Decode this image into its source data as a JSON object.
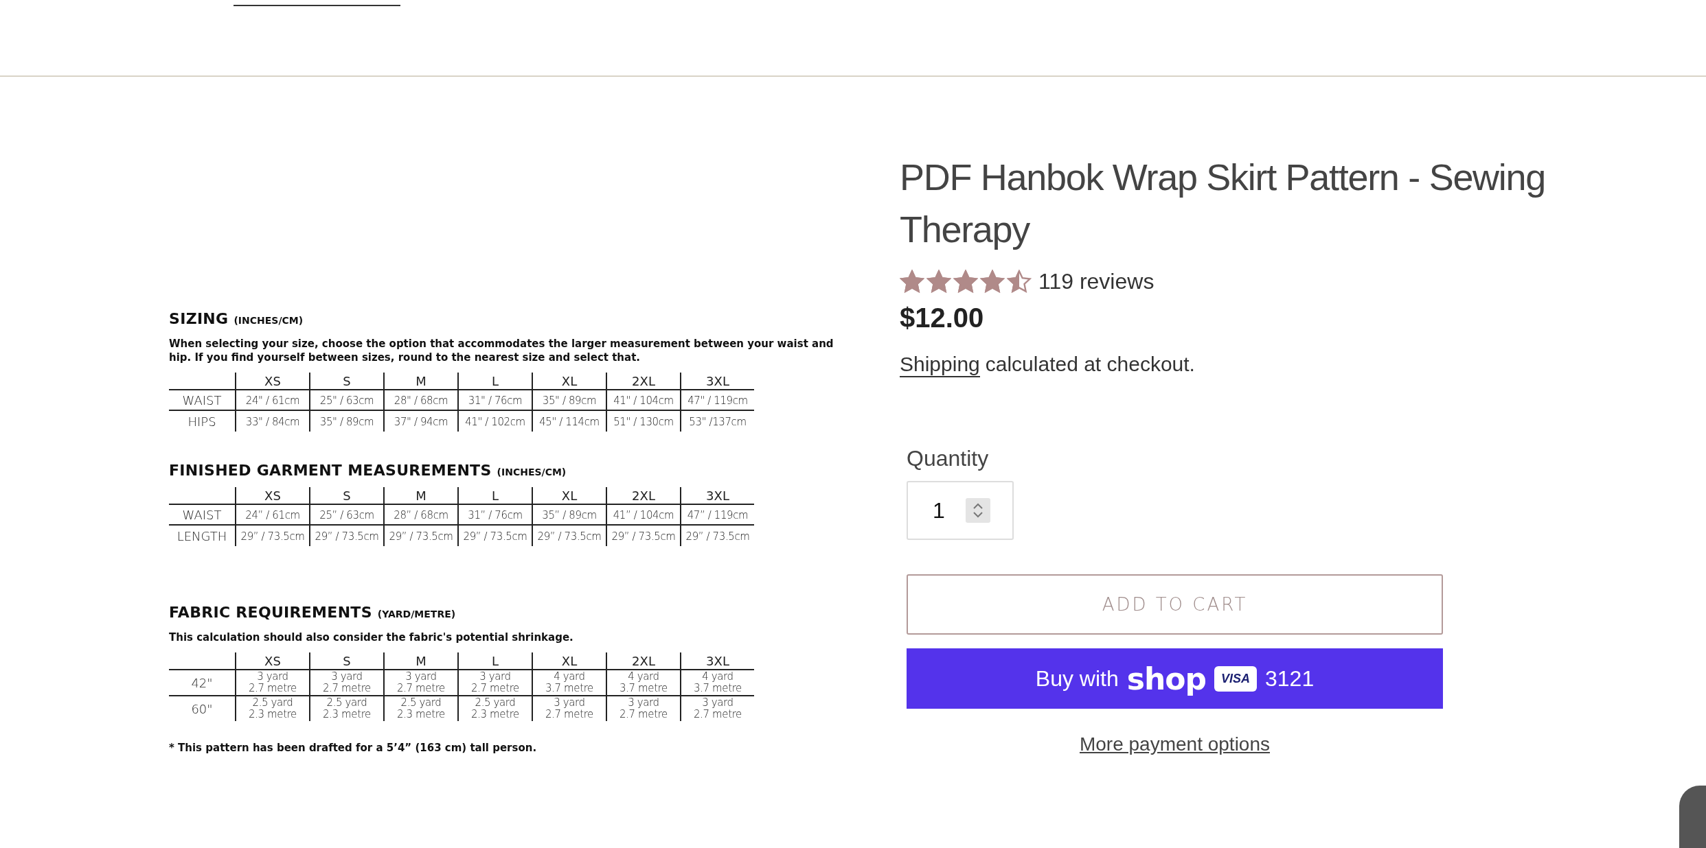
{
  "size_chart": {
    "sections": [
      {
        "heading": "SIZING",
        "unit": "(INCHES/CM)",
        "note": "When selecting your size, choose the option that accommodates the larger measurement between your waist and hip. If you find yourself between sizes, round to the nearest size and select that.",
        "columns": [
          "XS",
          "S",
          "M",
          "L",
          "XL",
          "2XL",
          "3XL"
        ],
        "rows": [
          {
            "label": "WAIST",
            "cells": [
              "24\" / 61cm",
              "25\" / 63cm",
              "28\" / 68cm",
              "31\" / 76cm",
              "35\" / 89cm",
              "41\" / 104cm",
              "47\" / 119cm"
            ]
          },
          {
            "label": "HIPS",
            "cells": [
              "33\" / 84cm",
              "35\" / 89cm",
              "37\" / 94cm",
              "41\" / 102cm",
              "45\" / 114cm",
              "51\" / 130cm",
              "53\" /137cm"
            ]
          }
        ]
      },
      {
        "heading": "FINISHED GARMENT MEASUREMENTS",
        "unit": "(INCHES/CM)",
        "columns": [
          "XS",
          "S",
          "M",
          "L",
          "XL",
          "2XL",
          "3XL"
        ],
        "rows": [
          {
            "label": "WAIST",
            "cells": [
              "24” / 61cm",
              "25” / 63cm",
              "28” / 68cm",
              "31” / 76cm",
              "35” / 89cm",
              "41” / 104cm",
              "47” / 119cm"
            ]
          },
          {
            "label": "LENGTH",
            "cells": [
              "29” / 73.5cm",
              "29” / 73.5cm",
              "29” / 73.5cm",
              "29” / 73.5cm",
              "29” / 73.5cm",
              "29” / 73.5cm",
              "29” / 73.5cm"
            ]
          }
        ]
      },
      {
        "heading": "FABRIC REQUIREMENTS",
        "unit": "(YARD/METRE)",
        "note": "This calculation should also consider the fabric's potential shrinkage.",
        "columns": [
          "XS",
          "S",
          "M",
          "L",
          "XL",
          "2XL",
          "3XL"
        ],
        "rows": [
          {
            "label": "42\"",
            "cells": [
              "3 yard\n2.7 metre",
              "3 yard\n2.7 metre",
              "3 yard\n2.7 metre",
              "3 yard\n2.7 metre",
              "4 yard\n3.7 metre",
              "4 yard\n3.7 metre",
              "4 yard\n3.7 metre"
            ]
          },
          {
            "label": "60\"",
            "cells": [
              "2.5 yard\n2.3 metre",
              "2.5 yard\n2.3 metre",
              "2.5 yard\n2.3 metre",
              "2.5 yard\n2.3 metre",
              "3 yard\n2.7 metre",
              "3 yard\n2.7 metre",
              "3 yard\n2.7 metre"
            ]
          }
        ]
      }
    ],
    "footnote": "* This pattern has been drafted for a 5’4” (163 cm) tall person."
  },
  "product": {
    "title": "PDF Hanbok Wrap Skirt Pattern - Sewing Therapy",
    "stars": 4.5,
    "reviews": "119 reviews",
    "price": "$12.00",
    "shipping_link": "Shipping",
    "shipping_note": "calculated at checkout.",
    "quantity_label": "Quantity",
    "quantity": "1",
    "add_to_cart": "ADD TO CART",
    "buy_button": {
      "prefix": "Buy with",
      "logo": "shop",
      "card": "VISA",
      "number": "3121"
    },
    "more_options": "More payment options"
  }
}
